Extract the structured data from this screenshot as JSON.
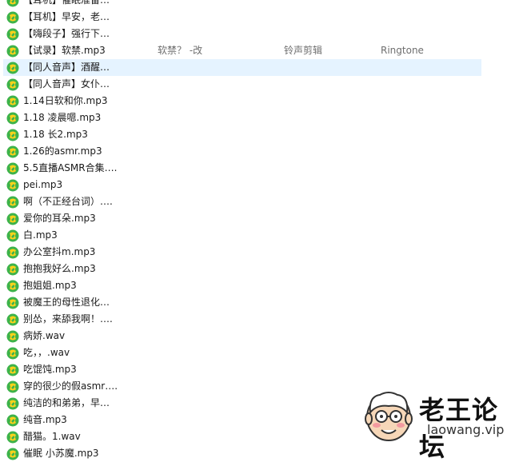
{
  "file_list": {
    "rows": [
      {
        "name": "【耳机】催眠准备…"
      },
      {
        "name": "【耳机】早安，老…"
      },
      {
        "name": "【嗨段子】强行下…"
      },
      {
        "name": "【试录】软禁.mp3",
        "title": "软禁？ -改",
        "artist": "铃声剪辑",
        "album": "Ringtone"
      },
      {
        "name": "【同人音声】酒醒…",
        "selected": true
      },
      {
        "name": "【同人音声】女仆…"
      },
      {
        "name": "1.14日软和你.mp3"
      },
      {
        "name": "1.18 凌晨嗯.mp3"
      },
      {
        "name": "1.18 长2.mp3"
      },
      {
        "name": "1.26的asmr.mp3"
      },
      {
        "name": "5.5直播ASMR合集…."
      },
      {
        "name": "pei.mp3"
      },
      {
        "name": "啊（不正经台词）…."
      },
      {
        "name": "爱你的耳朵.mp3"
      },
      {
        "name": "白.mp3"
      },
      {
        "name": "办公室抖m.mp3"
      },
      {
        "name": "抱抱我好么.mp3"
      },
      {
        "name": "抱姐姐.mp3"
      },
      {
        "name": "被魔王的母性退化…"
      },
      {
        "name": "别怂，来舔我啊！…."
      },
      {
        "name": "病娇.wav"
      },
      {
        "name": "吃，，.wav"
      },
      {
        "name": "吃馄饨.mp3"
      },
      {
        "name": "穿的很少的假asmr…."
      },
      {
        "name": "纯洁的和弟弟，早…"
      },
      {
        "name": "纯音.mp3"
      },
      {
        "name": "醋猫。1.wav"
      },
      {
        "name": "催眠 小苏魔.mp3"
      }
    ]
  },
  "watermark": {
    "title": "老王论坛",
    "url": "laowang.vip"
  },
  "colors": {
    "selection": "#e5f3ff",
    "icon_green": "#3db34a",
    "icon_yellow": "#ffd21a"
  },
  "icons": {
    "file": "qq-music-file-icon",
    "logo": "old-man-face-icon"
  }
}
